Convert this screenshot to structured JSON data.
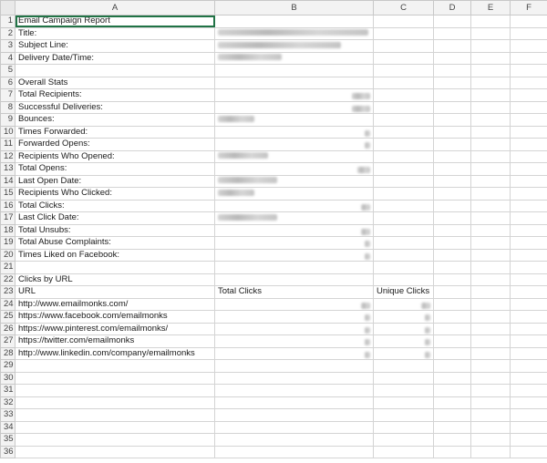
{
  "columns": [
    "A",
    "B",
    "C",
    "D",
    "E",
    "F"
  ],
  "rows": [
    {
      "n": "1",
      "a": "Email Campaign Report"
    },
    {
      "n": "2",
      "a": "Title:",
      "b_redact": 165
    },
    {
      "n": "3",
      "a": "Subject Line:",
      "b_redact": 135
    },
    {
      "n": "4",
      "a": "Delivery Date/Time:",
      "b_redact": 70
    },
    {
      "n": "5",
      "a": ""
    },
    {
      "n": "6",
      "a": "Overall Stats"
    },
    {
      "n": "7",
      "a": "Total Recipients:",
      "b_redact_r": 20
    },
    {
      "n": "8",
      "a": "Successful Deliveries:",
      "b_redact_r": 20
    },
    {
      "n": "9",
      "a": "Bounces:",
      "b_redact": 40
    },
    {
      "n": "10",
      "a": "Times Forwarded:",
      "b_redact_r": 6
    },
    {
      "n": "11",
      "a": "Forwarded Opens:",
      "b_redact_r": 6
    },
    {
      "n": "12",
      "a": "Recipients Who Opened:",
      "b_redact": 55
    },
    {
      "n": "13",
      "a": "Total Opens:",
      "b_redact_r": 14
    },
    {
      "n": "14",
      "a": "Last Open Date:",
      "b_redact": 65
    },
    {
      "n": "15",
      "a": "Recipients Who Clicked:",
      "b_redact": 40
    },
    {
      "n": "16",
      "a": "Total Clicks:",
      "b_redact_r": 10
    },
    {
      "n": "17",
      "a": "Last Click Date:",
      "b_redact": 65
    },
    {
      "n": "18",
      "a": "Total Unsubs:",
      "b_redact_r": 10
    },
    {
      "n": "19",
      "a": "Total Abuse Complaints:",
      "b_redact_r": 6
    },
    {
      "n": "20",
      "a": "Times Liked on Facebook:",
      "b_redact_r": 6
    },
    {
      "n": "21",
      "a": ""
    },
    {
      "n": "22",
      "a": "Clicks by URL"
    },
    {
      "n": "23",
      "a": "URL",
      "b": "Total Clicks",
      "c": "Unique Clicks"
    },
    {
      "n": "24",
      "a": "http://www.emailmonks.com/",
      "b_redact_r": 10,
      "c_redact_r": 10
    },
    {
      "n": "25",
      "a": "https://www.facebook.com/emailmonks",
      "b_redact_r": 6,
      "c_redact_r": 6
    },
    {
      "n": "26",
      "a": "https://www.pinterest.com/emailmonks/",
      "b_redact_r": 6,
      "c_redact_r": 6
    },
    {
      "n": "27",
      "a": "https://twitter.com/emailmonks",
      "b_redact_r": 6,
      "c_redact_r": 6
    },
    {
      "n": "28",
      "a": "http://www.linkedin.com/company/emailmonks",
      "b_redact_r": 6,
      "c_redact_r": 6
    },
    {
      "n": "29",
      "a": ""
    },
    {
      "n": "30",
      "a": ""
    },
    {
      "n": "31",
      "a": ""
    },
    {
      "n": "32",
      "a": ""
    },
    {
      "n": "33",
      "a": ""
    },
    {
      "n": "34",
      "a": ""
    },
    {
      "n": "35",
      "a": ""
    },
    {
      "n": "36",
      "a": ""
    }
  ]
}
